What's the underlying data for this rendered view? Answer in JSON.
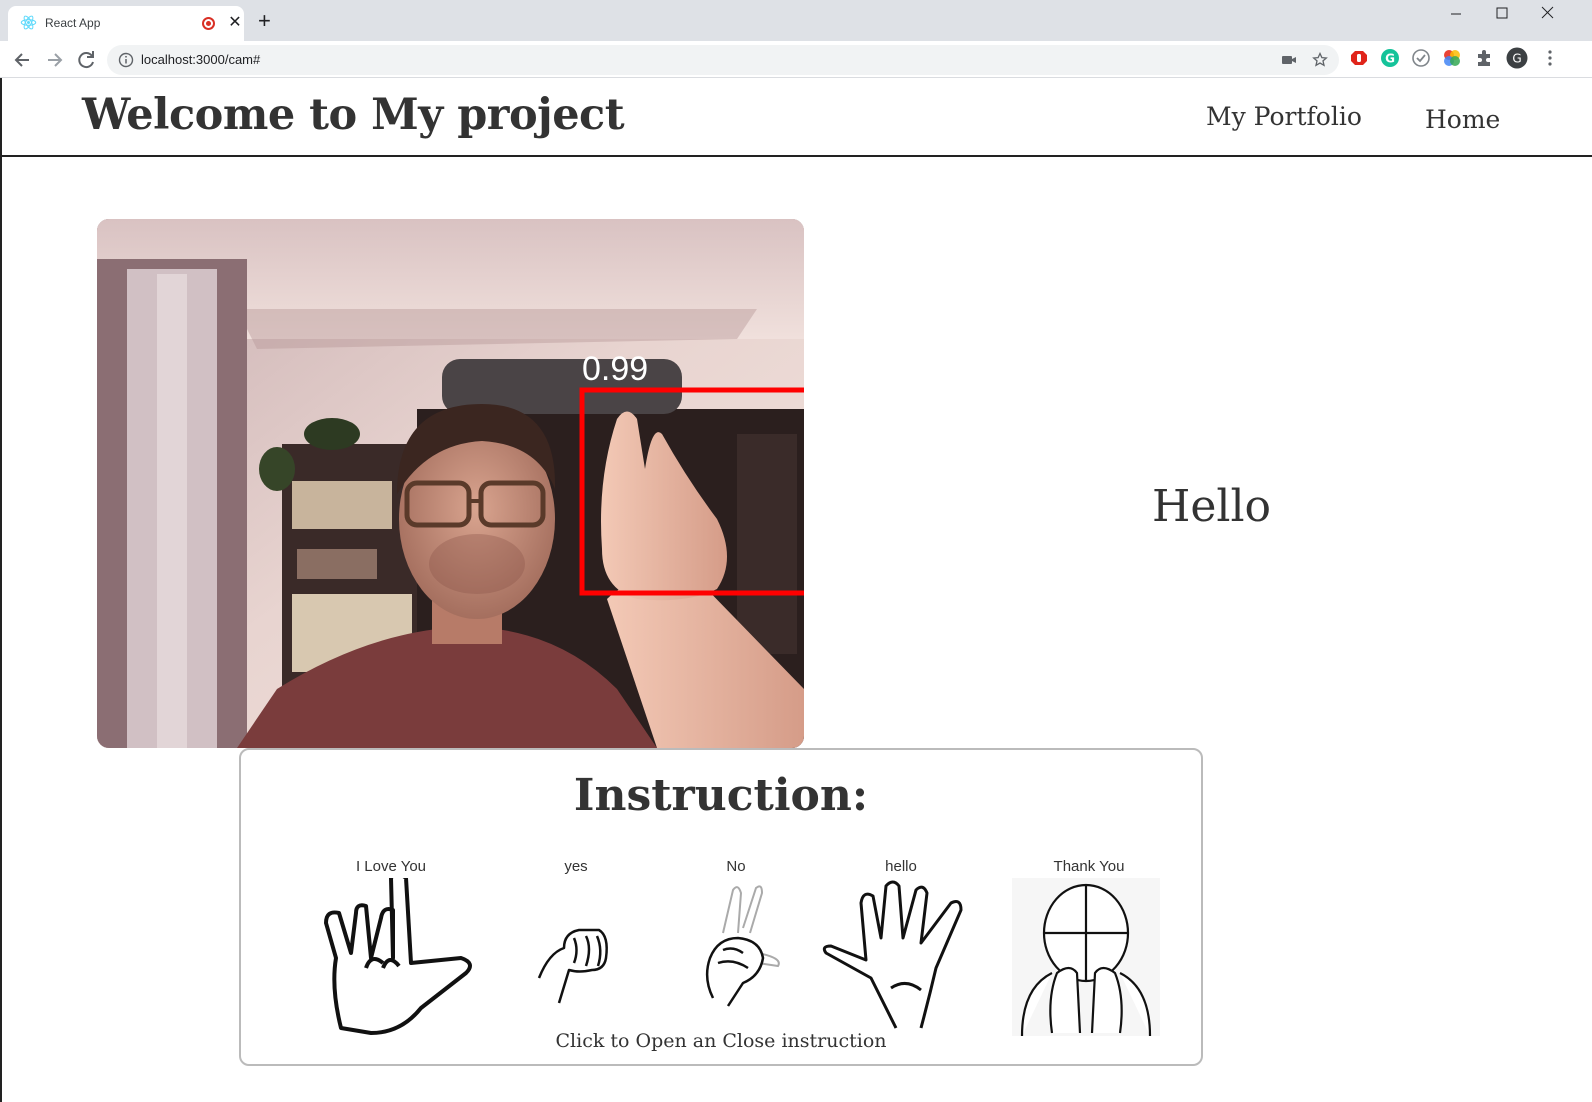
{
  "browser": {
    "tab_title": "React App",
    "url": "localhost:3000/cam#"
  },
  "header": {
    "title": "Welcome to My project",
    "nav": [
      {
        "label": "My Portfolio"
      },
      {
        "label": "Home"
      }
    ]
  },
  "camera": {
    "detection_score": "0.99",
    "box_color": "#ff0000"
  },
  "result": {
    "text": "Hello"
  },
  "instruction": {
    "title": "Instruction:",
    "signs": [
      {
        "label": "I Love You",
        "icon": "i-love-you-hand-icon"
      },
      {
        "label": "yes",
        "icon": "yes-fist-icon"
      },
      {
        "label": "No",
        "icon": "no-hand-icon"
      },
      {
        "label": "hello",
        "icon": "hello-open-hand-icon"
      },
      {
        "label": "Thank You",
        "icon": "thank-you-face-hands-icon"
      }
    ],
    "toggle_text": "Click to Open an Close instruction"
  }
}
